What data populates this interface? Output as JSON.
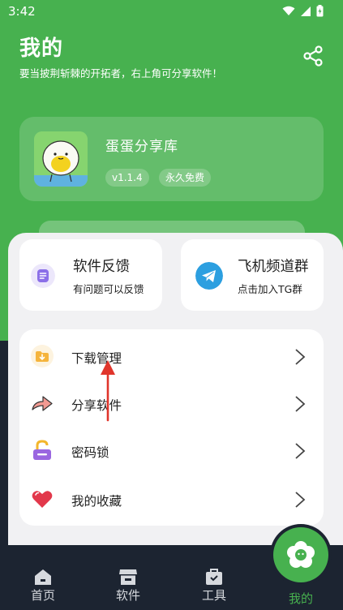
{
  "status_bar": {
    "time": "3:42"
  },
  "header": {
    "title": "我的",
    "subtitle": "要当披荆斩棘的开拓者，右上角可分享软件！"
  },
  "app_card": {
    "name": "蛋蛋分享库",
    "version": "v1.1.4",
    "license": "永久免费"
  },
  "quick_cards": [
    {
      "title": "软件反馈",
      "subtitle": "有问题可以反馈",
      "icon": "feedback-icon"
    },
    {
      "title": "飞机频道群",
      "subtitle": "点击加入TG群",
      "icon": "telegram-icon"
    }
  ],
  "menu": [
    {
      "label": "下载管理",
      "icon": "download-folder-icon"
    },
    {
      "label": "分享软件",
      "icon": "share-arrow-icon"
    },
    {
      "label": "密码锁",
      "icon": "lock-icon"
    },
    {
      "label": "我的收藏",
      "icon": "heart-icon"
    }
  ],
  "nav": [
    {
      "label": "首页",
      "icon": "home-icon"
    },
    {
      "label": "软件",
      "icon": "store-icon"
    },
    {
      "label": "工具",
      "icon": "toolbox-icon"
    },
    {
      "label": "我的",
      "icon": "profile-flower-icon",
      "active": true
    }
  ],
  "colors": {
    "primary_green": "#47b14f",
    "nav_bg": "#1c2431",
    "panel_bg": "#f1f1f3",
    "annotation_red": "#e0352b"
  }
}
